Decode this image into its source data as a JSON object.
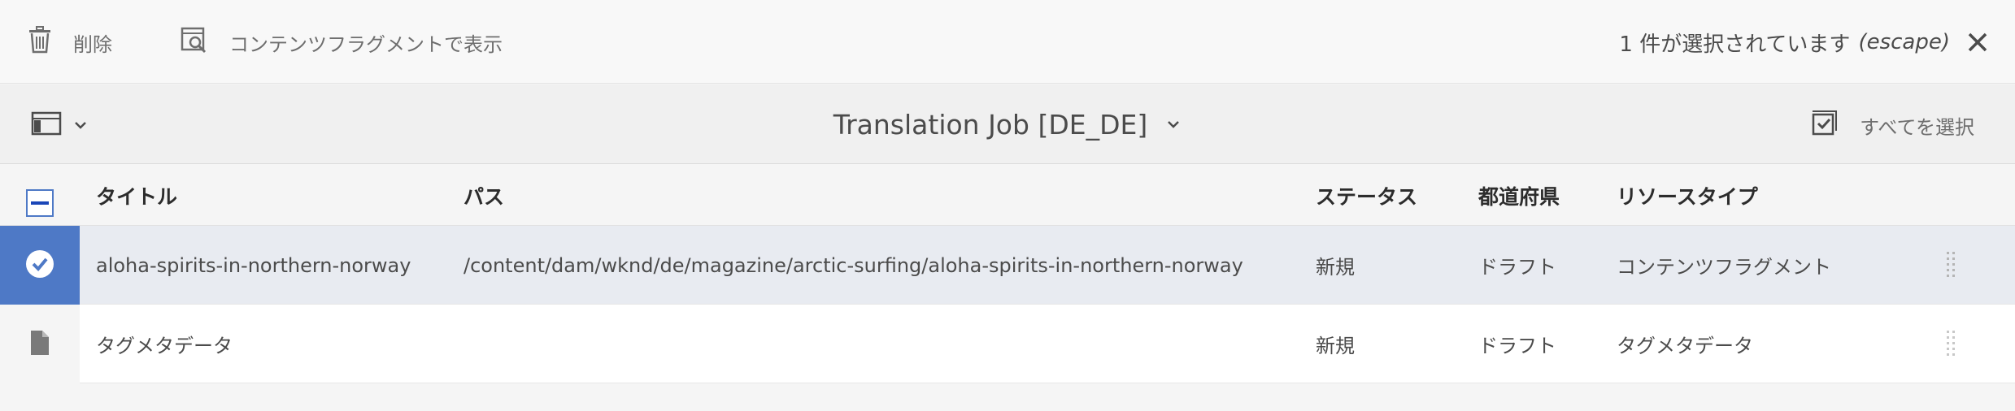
{
  "actionbar": {
    "delete_label": "削除",
    "view_as_fragment_label": "コンテンツフラグメントで表示",
    "selection_text": "1 件が選択されています",
    "escape_hint": "(escape)"
  },
  "titlebar": {
    "title": "Translation Job [DE_DE]",
    "select_all_label": "すべてを選択"
  },
  "table": {
    "headers": {
      "title": "タイトル",
      "path": "パス",
      "status": "ステータス",
      "prefecture": "都道府県",
      "resource_type": "リソースタイプ"
    },
    "rows": [
      {
        "title": "aloha-spirits-in-northern-norway",
        "path": "/content/dam/wknd/de/magazine/arctic-surfing/aloha-spirits-in-northern-norway",
        "status": "新規",
        "prefecture": "ドラフト",
        "resource_type": "コンテンツフラグメント",
        "selected": true
      },
      {
        "title": "タグメタデータ",
        "path": "",
        "status": "新規",
        "prefecture": "ドラフト",
        "resource_type": "タグメタデータ",
        "selected": false
      }
    ]
  },
  "colors": {
    "accent": "#4e79c6",
    "selected_row": "#e8ebf1",
    "text": "#4b4b4b"
  },
  "icons": [
    "trash-icon",
    "view-fragment-icon",
    "close-icon",
    "rail-toggle-icon",
    "chevron-down-icon",
    "select-all-icon",
    "checkbox-indeterminate-icon",
    "checkmark-circle-icon",
    "file-icon",
    "drag-handle-icon"
  ]
}
